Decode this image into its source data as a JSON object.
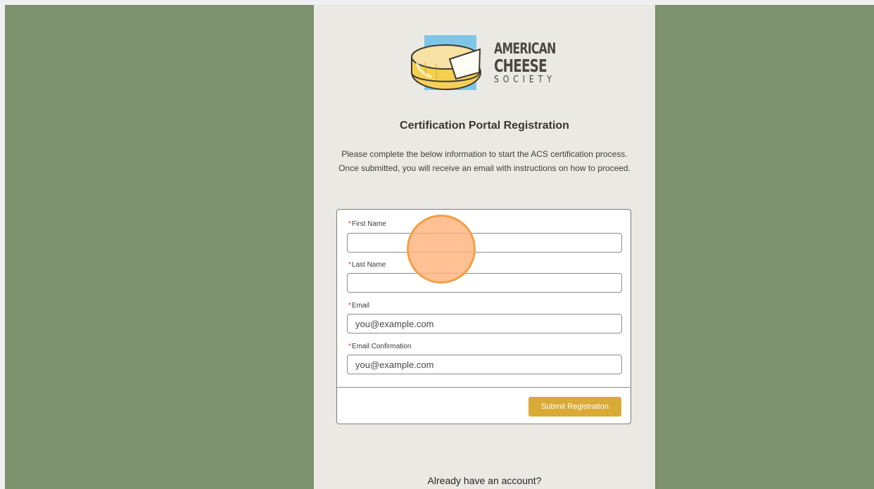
{
  "logo": {
    "line1": "American",
    "line2": "Cheese",
    "line3": "Society"
  },
  "page": {
    "title": "Certification Portal Registration",
    "intro": "Please complete the below information to start the ACS certification process. Once submitted, you will receive an email with instructions on how to proceed."
  },
  "form": {
    "required_marker": "*",
    "first_name": {
      "label": "First Name",
      "placeholder": ""
    },
    "last_name": {
      "label": "Last Name",
      "placeholder": ""
    },
    "email": {
      "label": "Email",
      "placeholder": "you@example.com"
    },
    "email_confirmation": {
      "label": "Email Confirmation",
      "placeholder": "you@example.com"
    },
    "submit_label": "Submit Registration"
  },
  "footer": {
    "account_prompt": "Already have an account?"
  },
  "colors": {
    "background": "#7d926e",
    "panel": "#ebe9e4",
    "button": "#d9aa36",
    "required": "#c23934",
    "click_marker": "#f2a046"
  }
}
